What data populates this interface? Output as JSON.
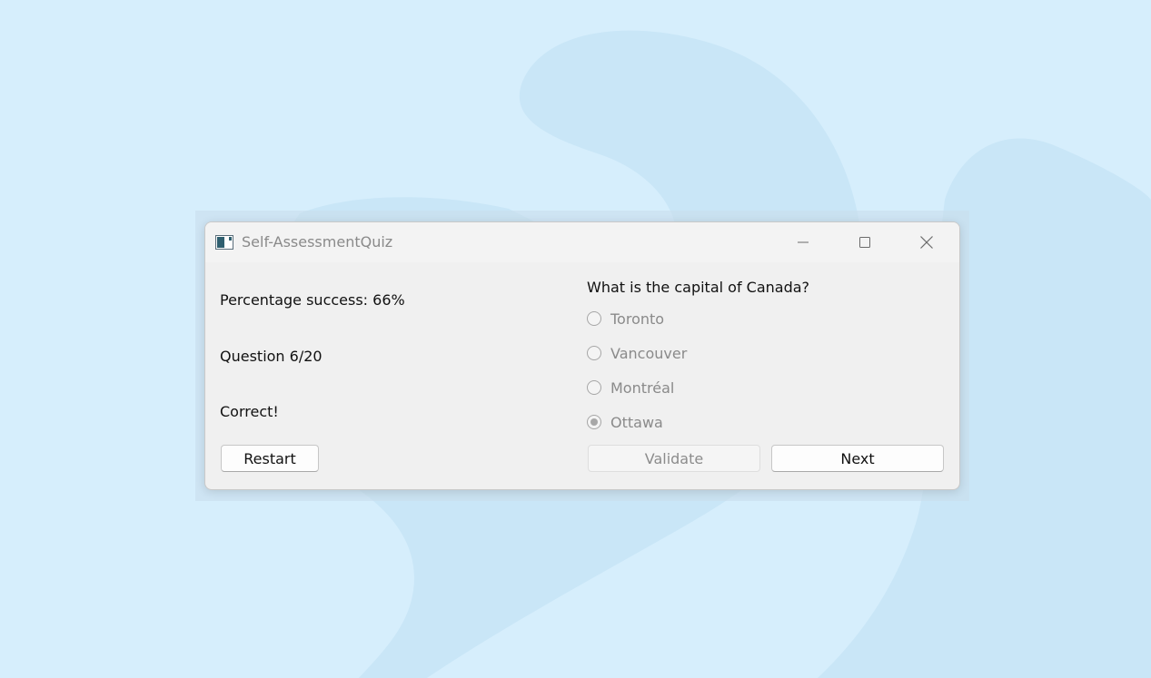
{
  "window": {
    "title": "Self-AssessmentQuiz",
    "app_icon": "window-app-icon",
    "minimize_icon": "minimize-icon",
    "maximize_icon": "maximize-icon",
    "close_icon": "close-icon"
  },
  "stats": {
    "percentage": "Percentage success: 66%",
    "question_counter": "Question 6/20",
    "feedback": "Correct!"
  },
  "quiz": {
    "question": "What is the capital of Canada?",
    "options": [
      {
        "label": "Toronto",
        "checked": false
      },
      {
        "label": "Vancouver",
        "checked": false
      },
      {
        "label": "Montréal",
        "checked": false
      },
      {
        "label": "Ottawa",
        "checked": true
      }
    ]
  },
  "buttons": {
    "restart": "Restart",
    "validate": "Validate",
    "next": "Next"
  },
  "colors": {
    "desktop_bg": "#d6eefc",
    "window_bg": "#f0f0f0",
    "disabled_text": "#8a8a8a"
  }
}
